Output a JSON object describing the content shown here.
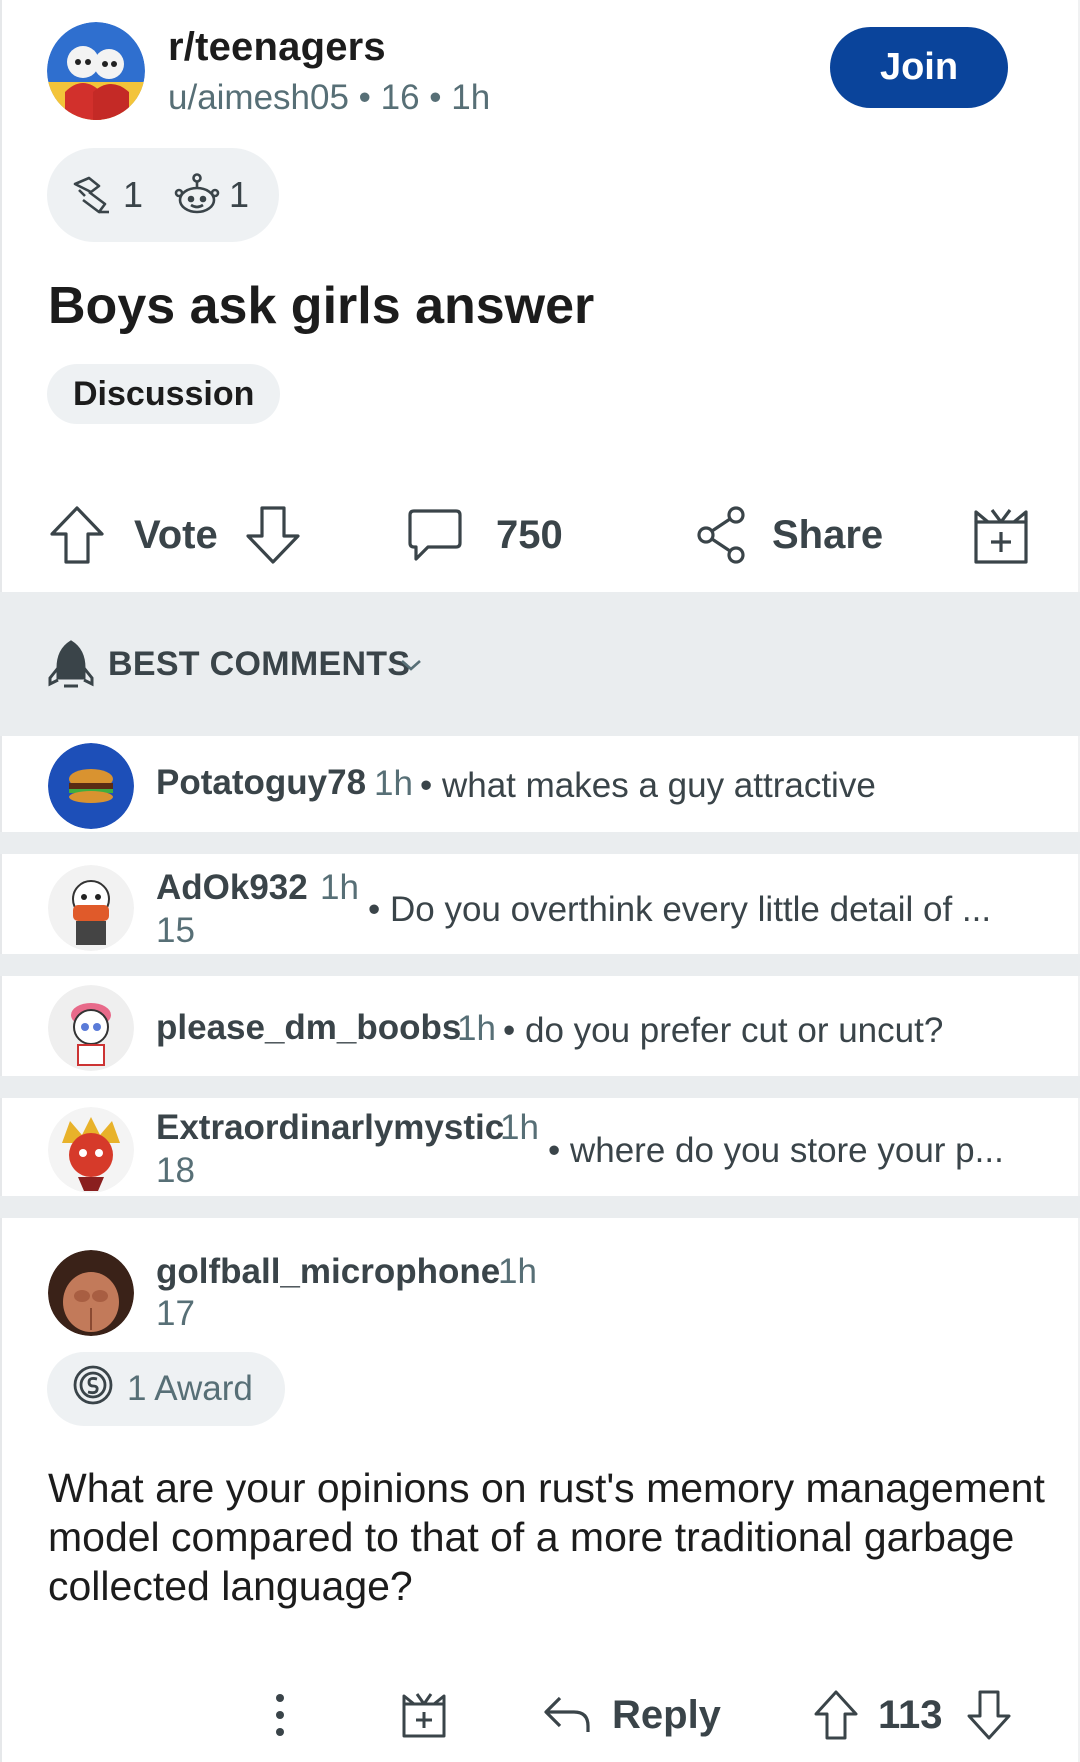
{
  "post": {
    "subreddit": "r/teenagers",
    "meta": "u/aimesh05 • 16 • 1h",
    "join_label": "Join",
    "award_counts": [
      "1",
      "1"
    ],
    "title": "Boys ask girls answer",
    "flair": "Discussion"
  },
  "actions": {
    "vote_label": "Vote",
    "comment_count": "750",
    "share_label": "Share"
  },
  "comments_header": {
    "sort_label": "BEST COMMENTS"
  },
  "comments": [
    {
      "user": "Potatoguy78",
      "time": "1h",
      "preview": "• what makes a guy attractive",
      "score": ""
    },
    {
      "user": "AdOk932",
      "time": "1h",
      "preview": "• Do you overthink every little detail of ...",
      "score": "15"
    },
    {
      "user": "please_dm_boobs",
      "time": "1h",
      "preview": "• do you prefer cut or uncut?",
      "score": ""
    },
    {
      "user": "Extraordinarlymystic",
      "time": "1h",
      "preview": "• where do you store your p...",
      "score": "18"
    }
  ],
  "expanded_comment": {
    "user": "golfball_microphone",
    "time": "1h",
    "score": "17",
    "award_label": "1 Award",
    "body": "What are your opinions on rust's memory management model compared to that of a more traditional garbage collected language?",
    "reply_label": "Reply",
    "votes": "113"
  },
  "icons": [
    "subreddit-avatar",
    "helpful-award-icon",
    "snoo-award-icon",
    "upvote-icon",
    "downvote-icon",
    "comment-icon",
    "share-icon",
    "gift-icon",
    "rocket-icon",
    "chevron-down-icon",
    "silver-award-icon",
    "more-icon",
    "reply-icon"
  ],
  "colors": {
    "join_button": "#0a449b",
    "band": "#eaedef",
    "pill": "#eef1f3"
  }
}
